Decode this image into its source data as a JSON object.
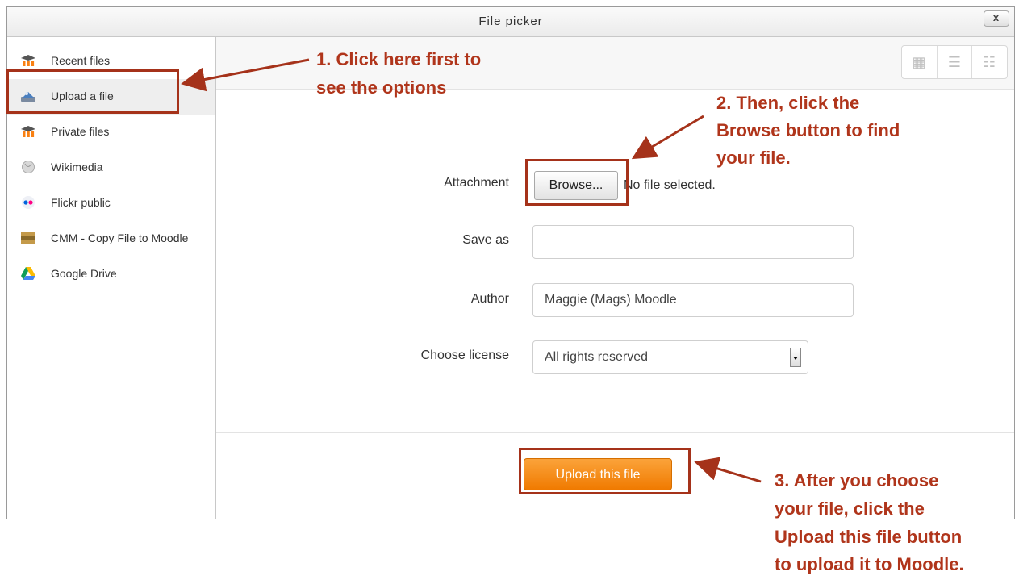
{
  "dialog": {
    "title": "File picker",
    "close_label": "x"
  },
  "sidebar": {
    "items": [
      {
        "label": "Recent files",
        "icon": "moodle-icon",
        "active": false
      },
      {
        "label": "Upload a file",
        "icon": "upload-icon",
        "active": true
      },
      {
        "label": "Private files",
        "icon": "moodle-icon",
        "active": false
      },
      {
        "label": "Wikimedia",
        "icon": "wikimedia-icon",
        "active": false
      },
      {
        "label": "Flickr public",
        "icon": "flickr-icon",
        "active": false
      },
      {
        "label": "CMM - Copy File to Moodle",
        "icon": "cmm-icon",
        "active": false
      },
      {
        "label": "Google Drive",
        "icon": "google-drive-icon",
        "active": false
      }
    ]
  },
  "toolbar": {
    "view_icons": [
      "grid-view-icon",
      "list-view-icon",
      "tree-view-icon"
    ]
  },
  "form": {
    "attachment_label": "Attachment",
    "browse_label": "Browse...",
    "no_file_text": "No file selected.",
    "saveas_label": "Save as",
    "saveas_value": "",
    "author_label": "Author",
    "author_value": "Maggie (Mags) Moodle",
    "license_label": "Choose license",
    "license_value": "All rights reserved"
  },
  "footer": {
    "upload_label": "Upload this file"
  },
  "annotations": {
    "step1_line1": "1. Click here first to",
    "step1_line2": "see the options",
    "step2_line1": "2. Then, click the",
    "step2_line2": "Browse button to find",
    "step2_line3": "your file.",
    "step3_line1": "3. After you choose",
    "step3_line2": "your file, click the",
    "step3_line3": "Upload this file button",
    "step3_line4": "to upload it to Moodle."
  },
  "colors": {
    "annotation": "#b0351b",
    "upload_button": "#f58a0b",
    "active_item": "#eeeeee"
  }
}
